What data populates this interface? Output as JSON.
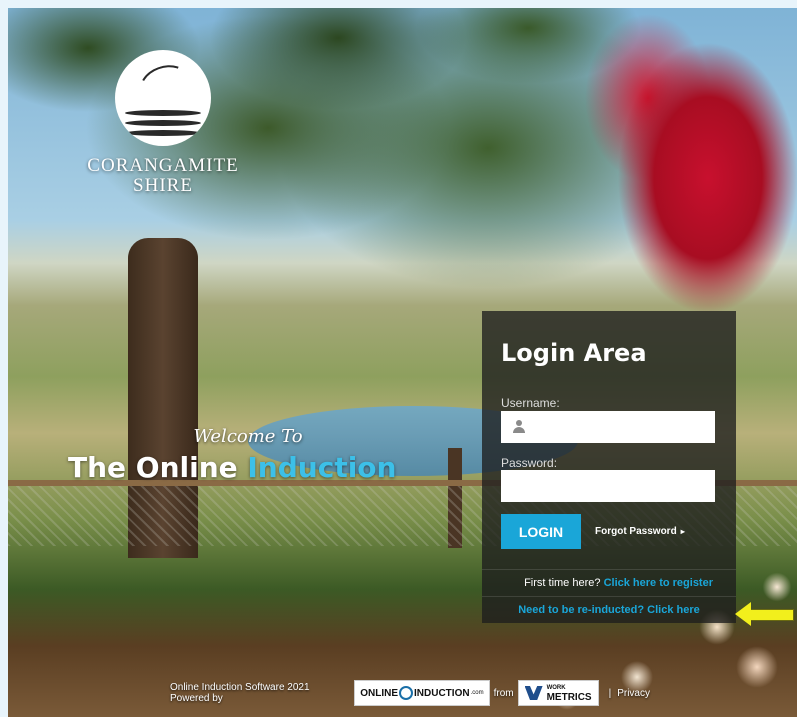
{
  "brand": {
    "org_name_line1": "CORANGAMITE",
    "org_name_line2": "SHIRE"
  },
  "welcome": {
    "script_text": "Welcome To",
    "title_part1": "The Online",
    "title_part2": "Induction"
  },
  "login": {
    "heading": "Login Area",
    "username_label": "Username:",
    "username_value": "",
    "password_label": "Password:",
    "password_value": "",
    "login_button": "LOGIN",
    "forgot_password": "Forgot Password",
    "first_time_text": "First time here?",
    "register_link": "Click here to register",
    "reinduct_link": "Need to be re-inducted? Click here"
  },
  "footer": {
    "text_before": "Online Induction Software 2021 Powered by",
    "logo1_left": "ONLINE",
    "logo1_right": "INDUCTION",
    "logo1_suffix": ".com",
    "text_from": "from",
    "logo2_small": "WORK",
    "logo2_big": "METRICS",
    "separator": "|",
    "privacy": "Privacy"
  },
  "colors": {
    "accent": "#1aa6d8",
    "arrow": "#f2ef1c",
    "panel_bg": "rgba(30,30,30,0.78)"
  }
}
